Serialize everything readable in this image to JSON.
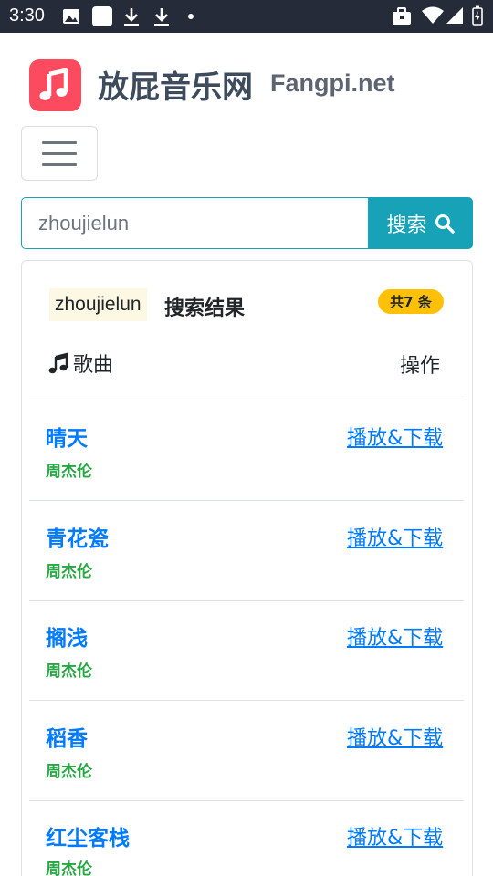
{
  "status_bar": {
    "time": "3:30",
    "left_icons": [
      "image-icon",
      "app-square-icon",
      "download-icon",
      "download-icon",
      "notification-dot-icon"
    ],
    "right_icons": [
      "briefcase-icon",
      "wifi-icon",
      "cellular-signal-icon",
      "battery-charging-icon"
    ]
  },
  "header": {
    "logo_icon": "music-note-icon",
    "title": "放屁音乐网",
    "domain": "Fangpi.net"
  },
  "search": {
    "value": "zhoujielun",
    "button_label": "搜索",
    "button_icon": "search-icon"
  },
  "results": {
    "keyword": "zhoujielun",
    "label": "搜索结果",
    "count_badge": "共7 条",
    "columns": {
      "song": "歌曲",
      "song_icon": "music-note-icon",
      "action": "操作"
    },
    "songs": [
      {
        "title": "晴天",
        "artist": "周杰伦",
        "action": "播放&下载"
      },
      {
        "title": "青花瓷",
        "artist": "周杰伦",
        "action": "播放&下载"
      },
      {
        "title": "搁浅",
        "artist": "周杰伦",
        "action": "播放&下载"
      },
      {
        "title": "稻香",
        "artist": "周杰伦",
        "action": "播放&下载"
      },
      {
        "title": "红尘客栈",
        "artist": "周杰伦",
        "action": "播放&下载"
      }
    ]
  },
  "colors": {
    "status_bar": "#262b3a",
    "logo": "#fc4a5e",
    "search_accent": "#17a2b8",
    "link": "#007bff",
    "artist": "#28a745",
    "badge": "#ffc107",
    "keyword_highlight": "#fcf8e3"
  }
}
